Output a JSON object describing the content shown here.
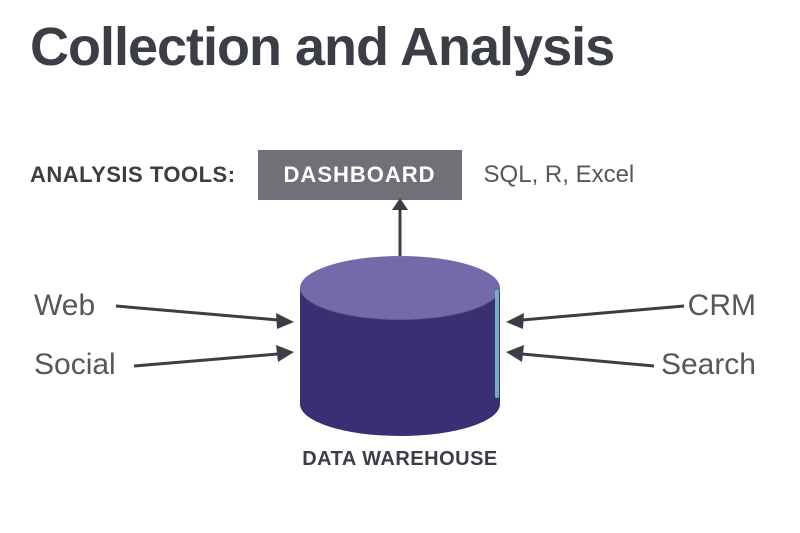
{
  "title": "Collection and Analysis",
  "tools": {
    "label": "ANALYSIS TOOLS:",
    "primary": "DASHBOARD",
    "secondary": "SQL, R, Excel"
  },
  "sources": {
    "left": [
      "Web",
      "Social"
    ],
    "right": [
      "CRM",
      "Search"
    ]
  },
  "warehouse_label": "DATA WAREHOUSE",
  "colors": {
    "text": "#3b3f45",
    "subtext": "#54585e",
    "box_bg": "#6f7176",
    "box_fg": "#ffffff",
    "cyl_side": "#3a2f72",
    "cyl_top": "#746aa9",
    "cyl_accent": "#7fb9c9"
  }
}
